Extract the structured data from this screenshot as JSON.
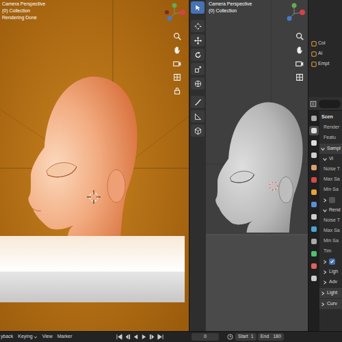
{
  "viewports": [
    {
      "overlay": [
        "Camera Perspective",
        "(0) Collection",
        "Rendering Done"
      ]
    },
    {
      "overlay": [
        "Camera Perspective",
        "(0) Collection"
      ]
    }
  ],
  "toolbar": {
    "tools": [
      {
        "selected": true
      },
      {
        "selected": false
      },
      {
        "selected": false
      },
      {
        "selected": false
      },
      {
        "selected": false
      },
      {
        "selected": false
      },
      {
        "selected": false
      },
      {
        "selected": false
      },
      {
        "selected": false
      }
    ]
  },
  "outliner": {
    "items": [
      {
        "label": "Col"
      },
      {
        "label": "Al"
      },
      {
        "label": "Empt"
      }
    ]
  },
  "properties": {
    "tabs": [
      {
        "selected": false,
        "color": "#aaaaaa"
      },
      {
        "selected": true,
        "color": "#dddddd"
      },
      {
        "selected": false,
        "color": "#dddddd"
      },
      {
        "selected": false,
        "color": "#cfcfcf"
      },
      {
        "selected": false,
        "color": "#d8a070"
      },
      {
        "selected": false,
        "color": "#d94848"
      },
      {
        "selected": false,
        "color": "#e8a23a"
      },
      {
        "selected": false,
        "color": "#5b8fd4"
      },
      {
        "selected": false,
        "color": "#cccccc"
      },
      {
        "selected": false,
        "color": "#4aa3d4"
      },
      {
        "selected": false,
        "color": "#aaaaaa"
      },
      {
        "selected": false,
        "color": "#4ec072"
      },
      {
        "selected": false,
        "color": "#e26060"
      },
      {
        "selected": false,
        "color": "#cccccc"
      }
    ],
    "rows": [
      {
        "kind": "title",
        "label": "Scen"
      },
      {
        "kind": "field",
        "label": "Render"
      },
      {
        "kind": "field",
        "label": "Featu"
      },
      {
        "kind": "panel",
        "label": "Sampl",
        "expanded": true
      },
      {
        "kind": "subpanel",
        "label": "Vi",
        "expanded": true
      },
      {
        "kind": "field",
        "label": "Noise T"
      },
      {
        "kind": "field",
        "label": "Max Sa"
      },
      {
        "kind": "field",
        "label": "Min Sa"
      },
      {
        "kind": "checkbox",
        "expanded": false,
        "checked": false
      },
      {
        "kind": "subpanel",
        "label": "Rend",
        "expanded": true
      },
      {
        "kind": "field",
        "label": "Noise T"
      },
      {
        "kind": "field",
        "label": "Max Sa"
      },
      {
        "kind": "field",
        "label": "Min Sa"
      },
      {
        "kind": "field",
        "label": "Tim"
      },
      {
        "kind": "checkbox",
        "expanded": false,
        "checked": true
      },
      {
        "kind": "subpanel",
        "label": "Ligh",
        "expanded": false
      },
      {
        "kind": "subpanel",
        "label": "Adv",
        "expanded": false
      },
      {
        "kind": "panel",
        "label": "Light",
        "expanded": false
      },
      {
        "kind": "panel",
        "label": "Curv",
        "expanded": false
      }
    ]
  },
  "timeline": {
    "menus": [
      "yback",
      "Keying",
      "View",
      "Marker"
    ],
    "frame": "0",
    "start_label": "Start",
    "start": "1",
    "end_label": "End",
    "end": "180"
  }
}
